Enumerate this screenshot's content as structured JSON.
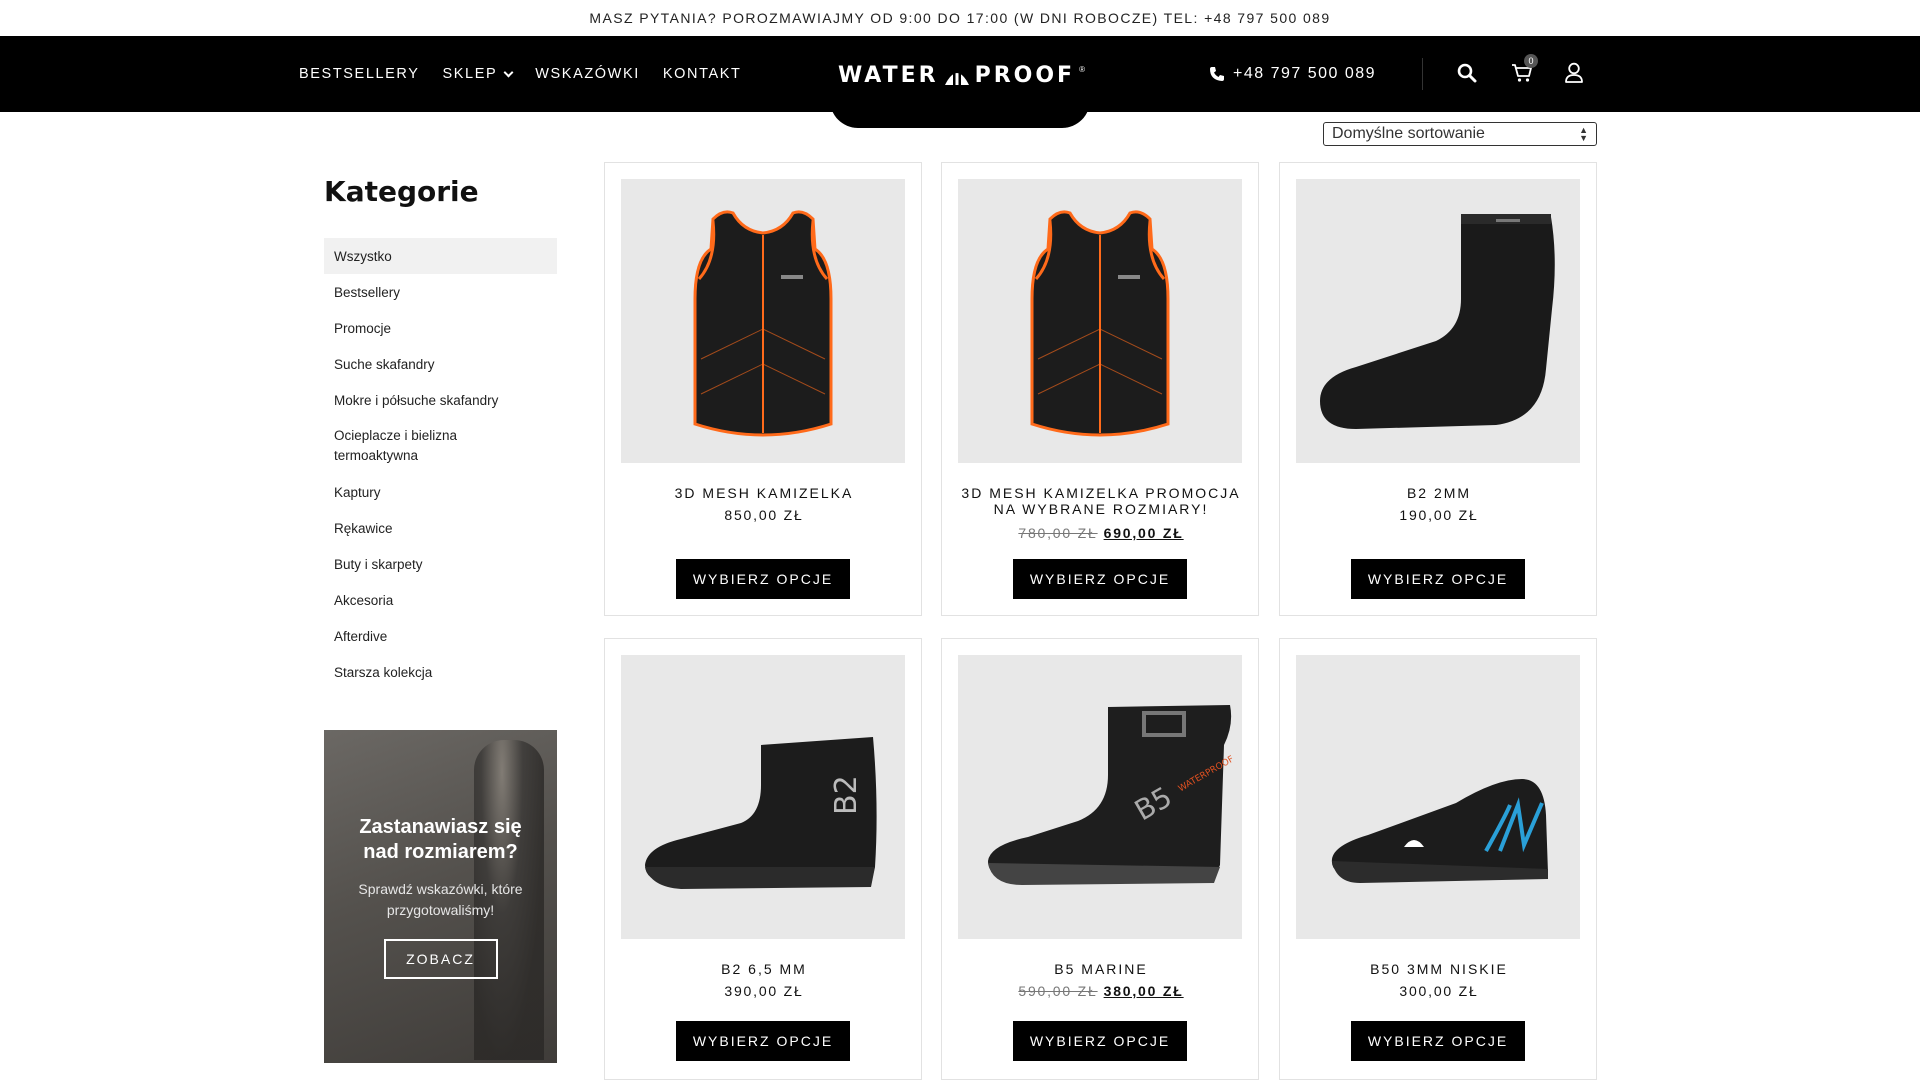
{
  "topbar": {
    "text": "MASZ PYTANIA? POROZMAWIAJMY OD 9:00 DO 17:00 (W DNI ROBOCZE) TEL: +48 797 500 089"
  },
  "nav": {
    "items": [
      "BESTSELLERY",
      "SKLEP",
      "WSKAZÓWKI",
      "KONTAKT"
    ]
  },
  "logo": {
    "left": "WATER",
    "right": "PROOF"
  },
  "header": {
    "phone": "+48 797 500 089",
    "cart_count": "0",
    "icons": [
      "phone-icon",
      "search-icon",
      "cart-icon",
      "user-icon"
    ]
  },
  "sort": {
    "selected": "Domyślne sortowanie"
  },
  "sidebar": {
    "title": "Kategorie",
    "categories": [
      "Wszystko",
      "Bestsellery",
      "Promocje",
      "Suche skafandry",
      "Mokre i półsuche skafandry",
      "Ocieplacze i bielizna termoaktywna",
      "Kaptury",
      "Rękawice",
      "Buty i skarpety",
      "Akcesoria",
      "Afterdive",
      "Starsza kolekcja"
    ],
    "active": "Wszystko",
    "promo": {
      "title": "Zastanawiasz się nad rozmiarem?",
      "text": "Sprawdź wskazówki, które przygotowaliśmy!",
      "button": "ZOBACZ"
    }
  },
  "products": [
    {
      "name": "3D MESH KAMIZELKA",
      "price": "850,00 ZŁ",
      "old_price": "",
      "button": "WYBIERZ OPCJE",
      "image": "vest"
    },
    {
      "name": "3D MESH KAMIZELKA PROMOCJA NA WYBRANE ROZMIARY!",
      "price": "690,00 ZŁ",
      "old_price": "780,00 ZŁ",
      "button": "WYBIERZ OPCJE",
      "image": "vest"
    },
    {
      "name": "B2 2MM",
      "price": "190,00 ZŁ",
      "old_price": "",
      "button": "WYBIERZ OPCJE",
      "image": "sock"
    },
    {
      "name": "B2 6,5 MM",
      "price": "390,00 ZŁ",
      "old_price": "",
      "button": "WYBIERZ OPCJE",
      "image": "boot-b2"
    },
    {
      "name": "B5 MARINE",
      "price": "380,00 ZŁ",
      "old_price": "590,00 ZŁ",
      "button": "WYBIERZ OPCJE",
      "image": "boot-b5"
    },
    {
      "name": "B50 3MM NISKIE",
      "price": "300,00 ZŁ",
      "old_price": "",
      "button": "WYBIERZ OPCJE",
      "image": "shoe-b50"
    }
  ],
  "colors": {
    "accent_orange": "#ff6a1a",
    "accent_blue": "#2aa0d8",
    "header_bg": "#000000"
  }
}
